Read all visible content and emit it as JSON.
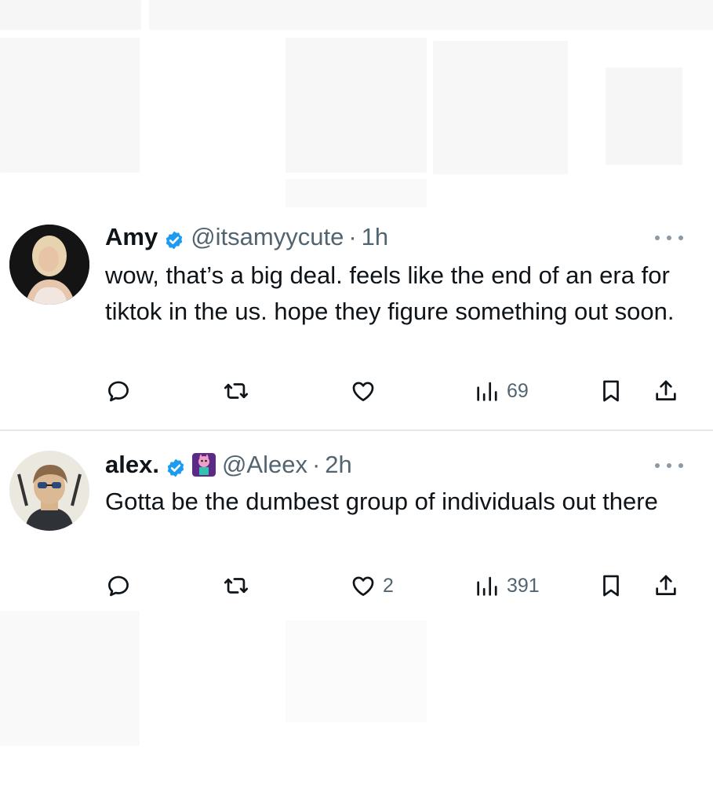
{
  "tweets": [
    {
      "name": "Amy",
      "handle": "@itsamyycute",
      "separator": "·",
      "time": "1h",
      "text": "wow, that’s a big deal. feels like the end of an era for tiktok in the us. hope they figure something out soon.",
      "actions": {
        "replies": "",
        "retweets": "",
        "likes": "",
        "views": "69"
      },
      "verified": true,
      "icons": [
        "reply-icon",
        "retweet-icon",
        "like-icon",
        "views-icon",
        "bookmark-icon",
        "share-icon",
        "more-icon",
        "verified-icon"
      ]
    },
    {
      "name": "alex.",
      "handle": "@Aleex",
      "separator": "·",
      "time": "2h",
      "text": "Gotta be the dumbest group of individuals out there",
      "actions": {
        "replies": "",
        "retweets": "",
        "likes": "2",
        "views": "391"
      },
      "verified": true,
      "icons": [
        "reply-icon",
        "retweet-icon",
        "like-icon",
        "views-icon",
        "bookmark-icon",
        "share-icon",
        "more-icon",
        "verified-icon",
        "affiliate-badge-icon"
      ]
    }
  ],
  "colors": {
    "text_primary": "#0f1419",
    "text_secondary": "#536471",
    "verified_blue": "#1d9bf0",
    "divider": "#e6e9eb"
  }
}
